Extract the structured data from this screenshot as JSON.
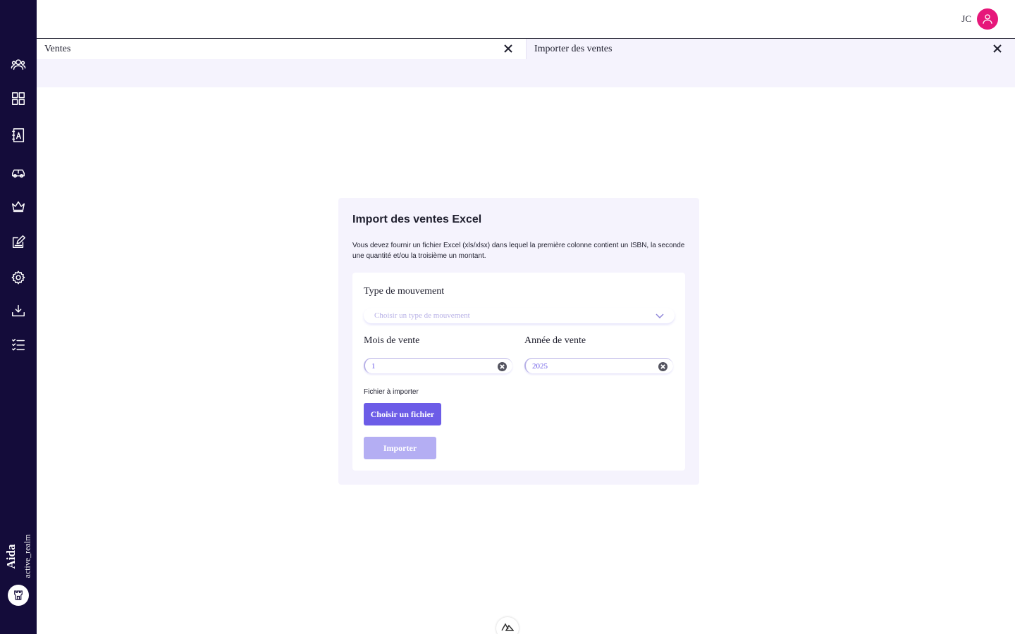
{
  "sidebar": {
    "brand_name": "Aida",
    "realm": "active_realm",
    "icons": [
      "users-icon",
      "dashboard-grid-icon",
      "contacts-book-icon",
      "car-icon",
      "crown-icon",
      "edit-document-icon",
      "gear-icon",
      "download-icon",
      "checklist-icon"
    ]
  },
  "topbar": {
    "user_initials": "JC"
  },
  "tabs": [
    {
      "label": "Ventes"
    },
    {
      "label": "Importer des ventes"
    }
  ],
  "import_card": {
    "title": "Import des ventes Excel",
    "description": "Vous devez fournir un fichier Excel (xls/xlsx) dans lequel la première colonne contient un ISBN, la seconde une quantité et/ou la troisième un montant.",
    "movement_type": {
      "label": "Type de mouvement",
      "placeholder": "Choisir un type de mouvement"
    },
    "sale_month": {
      "label": "Mois de vente",
      "value": "1"
    },
    "sale_year": {
      "label": "Année de vente",
      "value": "2025"
    },
    "file_label": "Fichier à importer",
    "choose_file_label": "Choisir un fichier",
    "import_label": "Importer"
  },
  "colors": {
    "sidebar_bg": "#140c3a",
    "accent": "#6c5ce7",
    "accent_disabled": "#b4aef3",
    "avatar": "#e6177a",
    "panel_bg": "#f5f3fd"
  }
}
